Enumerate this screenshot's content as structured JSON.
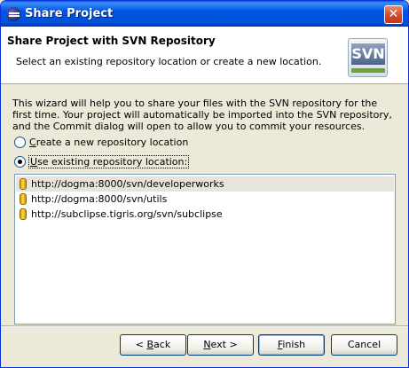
{
  "window": {
    "title": "Share Project",
    "close_glyph": "✕"
  },
  "header": {
    "title": "Share Project with SVN Repository",
    "description": "Select an existing repository location or create a new location.",
    "logo_text": "SVN"
  },
  "intro_text": "This wizard will help you to share your files with the SVN repository for the first time. Your project will automatically be imported into the SVN repository, and the Commit dialog will open to allow you to commit your resources.",
  "options": {
    "create_new": {
      "label_mnemonic": "C",
      "label_rest": "reate a new repository location",
      "checked": false
    },
    "use_existing": {
      "label_mnemonic": "U",
      "label_rest": "se existing repository location:",
      "checked": true
    }
  },
  "repositories": [
    {
      "url": "http://dogma:8000/svn/developerworks",
      "selected": true
    },
    {
      "url": "http://dogma:8000/svn/utils",
      "selected": false
    },
    {
      "url": "http://subclipse.tigris.org/svn/subclipse",
      "selected": false
    }
  ],
  "buttons": {
    "back": {
      "prefix": "< ",
      "mnemonic": "B",
      "rest": "ack"
    },
    "next": {
      "mnemonic": "N",
      "rest": "ext >"
    },
    "finish": {
      "mnemonic": "F",
      "rest": "inish"
    },
    "cancel": {
      "label": "Cancel"
    }
  },
  "icons": {
    "app": "eclipse-icon",
    "repository": "repository-icon",
    "close": "close-icon"
  },
  "colors": {
    "titlebar": "#0054e3",
    "dialog_bg": "#ece9d8",
    "selection_bg": "#e6e4dc"
  }
}
